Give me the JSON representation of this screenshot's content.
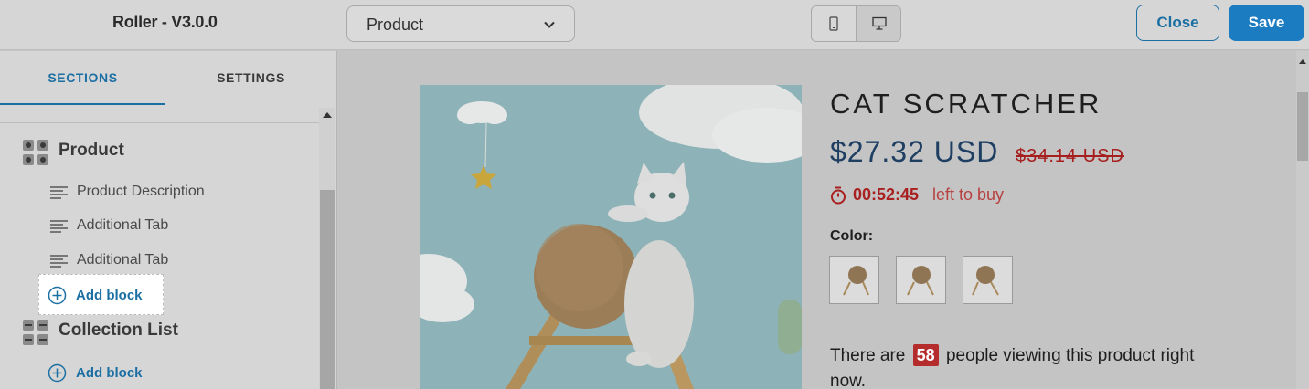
{
  "header": {
    "app_title": "Roller - V3.0.0",
    "page_select": {
      "value": "Product"
    },
    "device_toggle": {
      "options": [
        "mobile-icon",
        "desktop-icon"
      ],
      "selected": "desktop"
    },
    "close_label": "Close",
    "save_label": "Save"
  },
  "sidebar": {
    "tabs": [
      {
        "label": "SECTIONS",
        "active": true
      },
      {
        "label": "SETTINGS",
        "active": false
      }
    ],
    "sections": [
      {
        "name": "Product",
        "icon": "grid-icon",
        "blocks": [
          "Product Description",
          "Additional Tab",
          "Additional Tab"
        ],
        "add_block_label": "Add block"
      },
      {
        "name": "Collection List",
        "icon": "grid-icon",
        "blocks": [],
        "add_block_label": "Add block"
      }
    ]
  },
  "preview": {
    "product_title": "CAT SCRATCHER",
    "price": "$27.32 USD",
    "compare_price": "$34.14 USD",
    "timer": {
      "time": "00:52:45",
      "text": "left to buy"
    },
    "color_label": "Color:",
    "swatch_count": 3,
    "viewers": {
      "prefix": "There are",
      "count": "58",
      "suffix": "people viewing this product right now."
    }
  },
  "colors": {
    "accent": "#1b6fa3",
    "save_bg": "#1c7cc2",
    "price": "#1e3f62",
    "sale_red": "#a92020",
    "overlay_gray": "#c4c4c4"
  }
}
